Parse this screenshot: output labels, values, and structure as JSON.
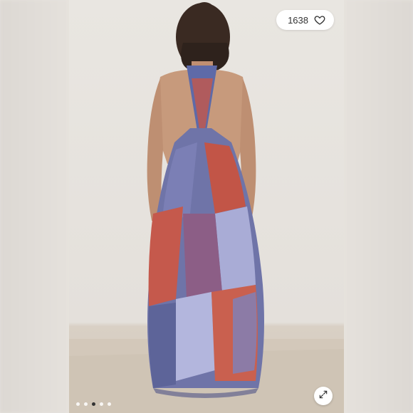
{
  "listing": {
    "like_count": "1638",
    "heart_icon": "heart-outline-icon",
    "expand_icon": "expand-arrows-icon"
  },
  "carousel": {
    "total_dots": 5,
    "active_index": 2
  },
  "colors": {
    "dress_blue": "#6f74a8",
    "dress_red": "#c5594c",
    "dress_lavender": "#a9acd6",
    "skin": "#c79a7c",
    "floor": "#d2c6b8"
  }
}
